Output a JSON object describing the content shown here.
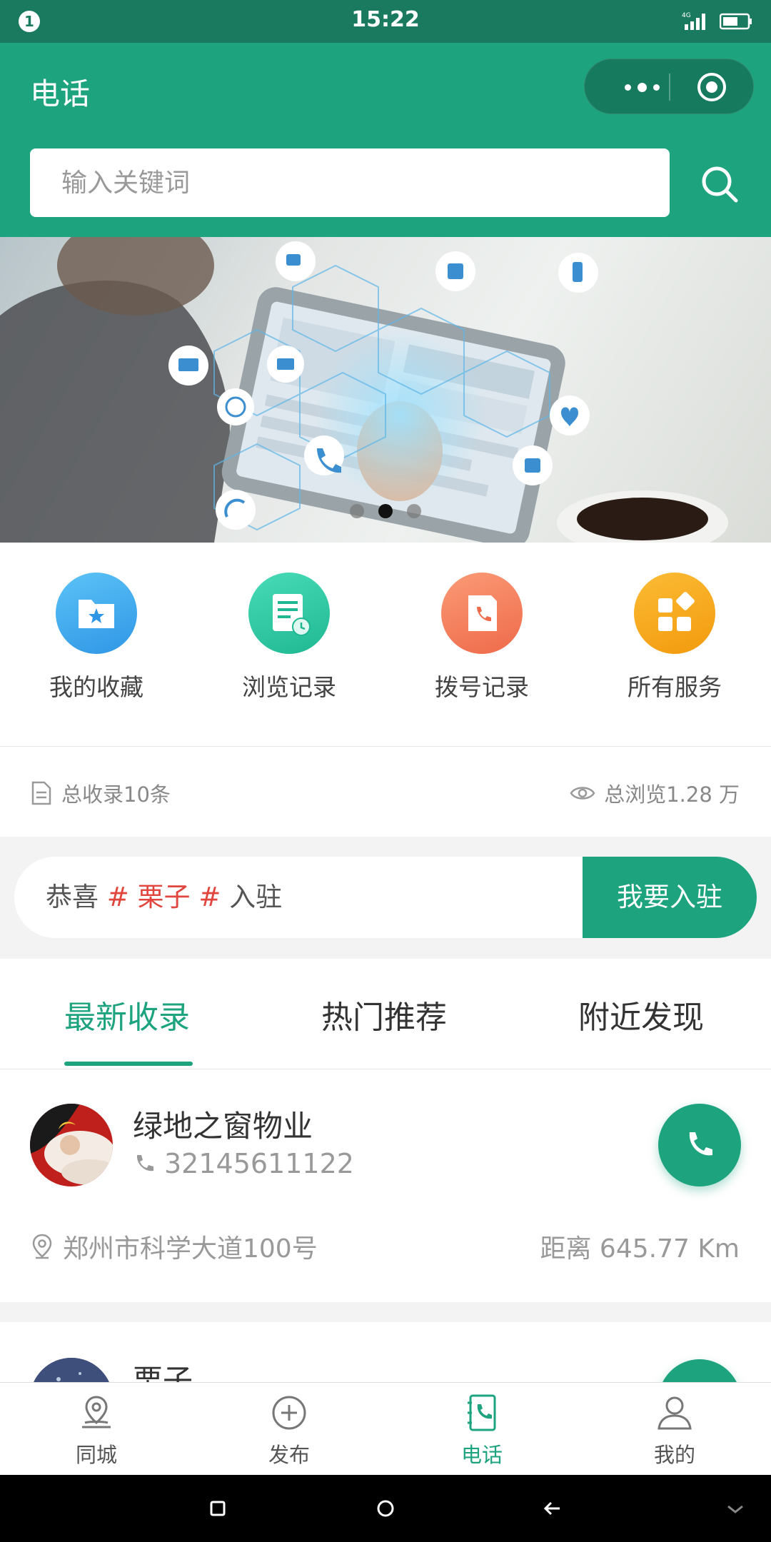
{
  "status_bar": {
    "notification_count": "1",
    "time": "15:22",
    "network": "4G"
  },
  "header": {
    "title": "电话"
  },
  "search": {
    "placeholder": "输入关键词"
  },
  "banner": {
    "slide_count": 3,
    "active_slide": 2
  },
  "quick_nav": [
    {
      "label": "我的收藏",
      "icon": "favorites-folder-icon",
      "color": "#39a8f0"
    },
    {
      "label": "浏览记录",
      "icon": "history-icon",
      "color": "#2cc7a2"
    },
    {
      "label": "拨号记录",
      "icon": "call-log-icon",
      "color": "#f27a58"
    },
    {
      "label": "所有服务",
      "icon": "grid-services-icon",
      "color": "#f7a81d"
    }
  ],
  "stats": {
    "total_listings": "总收录10条",
    "total_views": "总浏览1.28 万"
  },
  "join": {
    "prefix": "恭喜",
    "hash": "#",
    "name": "栗子",
    "suffix": "入驻",
    "button": "我要入驻"
  },
  "tabs": [
    {
      "label": "最新收录",
      "active": true
    },
    {
      "label": "热门推荐",
      "active": false
    },
    {
      "label": "附近发现",
      "active": false
    }
  ],
  "listings": [
    {
      "name": "绿地之窗物业",
      "phone": "32145611122",
      "address": "郑州市科学大道100号",
      "distance": "距离 645.77 Km"
    },
    {
      "name": "栗子"
    }
  ],
  "tabbar": [
    {
      "label": "同城",
      "icon": "location-pin-icon",
      "active": false
    },
    {
      "label": "发布",
      "icon": "plus-circle-icon",
      "active": false
    },
    {
      "label": "电话",
      "icon": "phone-book-icon",
      "active": true
    },
    {
      "label": "我的",
      "icon": "user-icon",
      "active": false
    }
  ],
  "colors": {
    "primary": "#1ea37f",
    "status_bar": "#1a7a5f",
    "accent_red": "#e0463e"
  }
}
